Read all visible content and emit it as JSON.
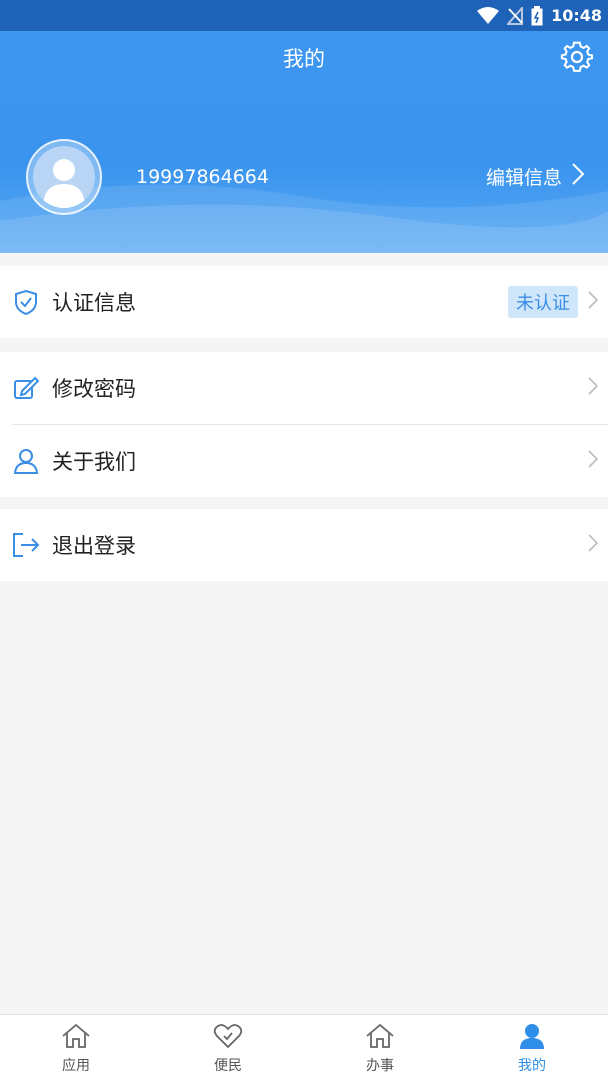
{
  "status_bar": {
    "time": "10:48"
  },
  "header": {
    "title": "我的",
    "phone": "19997864664",
    "edit_label": "编辑信息"
  },
  "menu": {
    "cert": {
      "label": "认证信息",
      "badge": "未认证"
    },
    "change_password": {
      "label": "修改密码"
    },
    "about": {
      "label": "关于我们"
    },
    "logout": {
      "label": "退出登录"
    }
  },
  "tabbar": [
    {
      "label": "应用",
      "icon": "home-icon",
      "active": false
    },
    {
      "label": "便民",
      "icon": "heart-icon",
      "active": false
    },
    {
      "label": "办事",
      "icon": "home-icon",
      "active": false
    },
    {
      "label": "我的",
      "icon": "person-icon",
      "active": true
    }
  ],
  "colors": {
    "primary": "#3a94ee",
    "status_bar": "#1f63b8",
    "badge_bg": "#cfe6fb",
    "active_tab": "#2f8ee8"
  }
}
